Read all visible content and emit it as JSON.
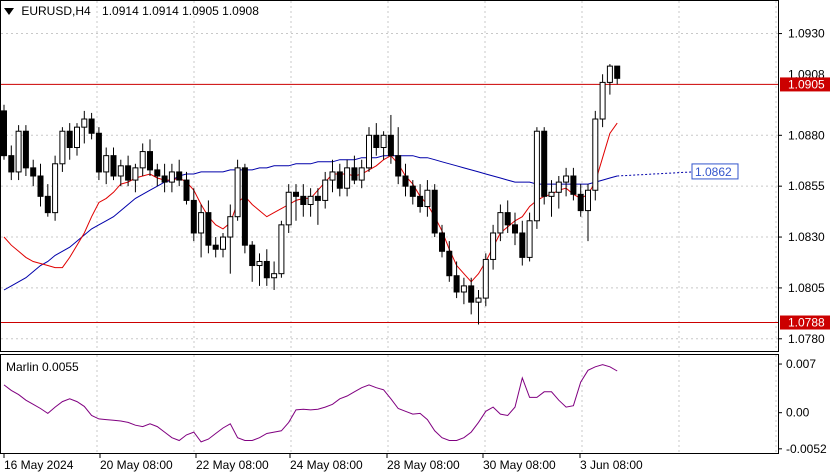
{
  "header": {
    "menu_icon": "triangle-down-icon",
    "symbol": "EURUSD,H4",
    "ohlc": "1.0914 1.0914 1.0905 1.0908"
  },
  "indicator": {
    "label": "Marlin 0.0055"
  },
  "price_axis": {
    "ticks": [
      "1.0930",
      "1.0880",
      "1.0855",
      "1.0830",
      "1.0805",
      "1.0780"
    ],
    "labels": {
      "current": "1.0908",
      "resistance": "1.0905",
      "support": "1.0788",
      "ma_projection": "1.0862"
    }
  },
  "indicator_axis": {
    "ticks": [
      "0.007",
      "0.00",
      "-0.0052"
    ]
  },
  "time_axis": {
    "ticks": [
      "16 May 2024",
      "20 May 08:00",
      "22 May 08:00",
      "24 May 08:00",
      "28 May 08:00",
      "30 May 08:00",
      "3 Jun 08:00"
    ]
  },
  "colors": {
    "background": "#ffffff",
    "grid": "#c8c8c8",
    "bull_body": "#ffffff",
    "bear_body": "#000000",
    "resistance_line": "#cc0000",
    "support_line": "#cc0000",
    "slow_ma": "#0000aa",
    "fast_ma": "#e00000",
    "oscillator": "#800080",
    "projection_label": "#3355cc"
  },
  "chart_data": [
    {
      "type": "candlestick",
      "title": "EURUSD,H4",
      "ylim": [
        1.0774,
        1.0946
      ],
      "x": [
        "16 May 2024",
        "20 May 08:00",
        "22 May 08:00",
        "24 May 08:00",
        "28 May 08:00",
        "30 May 08:00",
        "3 Jun 08:00"
      ],
      "horizontal_levels": [
        {
          "value": 1.0905,
          "label": "1.0905",
          "color": "#cc0000"
        },
        {
          "value": 1.0788,
          "label": "1.0788",
          "color": "#cc0000"
        }
      ],
      "ohlc": [
        [
          1.0892,
          1.0895,
          1.0868,
          1.087
        ],
        [
          1.087,
          1.0875,
          1.0858,
          1.0862
        ],
        [
          1.0862,
          1.0885,
          1.0858,
          1.0882
        ],
        [
          1.0882,
          1.0885,
          1.086,
          1.0864
        ],
        [
          1.0864,
          1.0868,
          1.0855,
          1.086
        ],
        [
          1.086,
          1.0866,
          1.0845,
          1.085
        ],
        [
          1.085,
          1.0856,
          1.084,
          1.0842
        ],
        [
          1.0842,
          1.087,
          1.0838,
          1.0866
        ],
        [
          1.0866,
          1.0884,
          1.0862,
          1.0882
        ],
        [
          1.0882,
          1.0886,
          1.0868,
          1.0874
        ],
        [
          1.0874,
          1.0886,
          1.087,
          1.0884
        ],
        [
          1.0884,
          1.0892,
          1.0876,
          1.0888
        ],
        [
          1.0888,
          1.0891,
          1.0878,
          1.0881
        ],
        [
          1.0881,
          1.0884,
          1.0858,
          1.0862
        ],
        [
          1.0862,
          1.0874,
          1.0856,
          1.087
        ],
        [
          1.087,
          1.0874,
          1.0858,
          1.086
        ],
        [
          1.086,
          1.0868,
          1.0855,
          1.0865
        ],
        [
          1.0865,
          1.087,
          1.0855,
          1.0858
        ],
        [
          1.0858,
          1.0866,
          1.0852,
          1.0864
        ],
        [
          1.0864,
          1.0876,
          1.086,
          1.0872
        ],
        [
          1.0872,
          1.0878,
          1.086,
          1.0863
        ],
        [
          1.0863,
          1.0866,
          1.0855,
          1.086
        ],
        [
          1.086,
          1.0866,
          1.0852,
          1.0857
        ],
        [
          1.0857,
          1.0866,
          1.0852,
          1.0862
        ],
        [
          1.0862,
          1.0868,
          1.0855,
          1.0858
        ],
        [
          1.0858,
          1.0862,
          1.0846,
          1.0848
        ],
        [
          1.0848,
          1.0854,
          1.0828,
          1.0832
        ],
        [
          1.0832,
          1.0846,
          1.082,
          1.0842
        ],
        [
          1.0842,
          1.0848,
          1.0822,
          1.0826
        ],
        [
          1.0826,
          1.083,
          1.082,
          1.0824
        ],
        [
          1.0824,
          1.0832,
          1.082,
          1.083
        ],
        [
          1.083,
          1.0846,
          1.0812,
          1.084
        ],
        [
          1.084,
          1.0868,
          1.0838,
          1.0864
        ],
        [
          1.0864,
          1.0866,
          1.0822,
          1.0826
        ],
        [
          1.0826,
          1.0828,
          1.0808,
          1.0816
        ],
        [
          1.0816,
          1.0822,
          1.0806,
          1.0818
        ],
        [
          1.0818,
          1.0824,
          1.0806,
          1.081
        ],
        [
          1.081,
          1.0818,
          1.0804,
          1.0812
        ],
        [
          1.0812,
          1.0838,
          1.081,
          1.0836
        ],
        [
          1.0836,
          1.0856,
          1.0832,
          1.0852
        ],
        [
          1.0852,
          1.0856,
          1.0838,
          1.085
        ],
        [
          1.085,
          1.0856,
          1.084,
          1.0846
        ],
        [
          1.0846,
          1.0854,
          1.084,
          1.085
        ],
        [
          1.085,
          1.0854,
          1.0836,
          1.0848
        ],
        [
          1.0848,
          1.0862,
          1.0844,
          1.0858
        ],
        [
          1.0858,
          1.0868,
          1.0852,
          1.0862
        ],
        [
          1.0862,
          1.0866,
          1.085,
          1.0854
        ],
        [
          1.0854,
          1.0868,
          1.085,
          1.0864
        ],
        [
          1.0864,
          1.087,
          1.0856,
          1.0858
        ],
        [
          1.0858,
          1.0868,
          1.0854,
          1.0864
        ],
        [
          1.0864,
          1.0884,
          1.0862,
          1.088
        ],
        [
          1.088,
          1.0886,
          1.087,
          1.0874
        ],
        [
          1.0874,
          1.0882,
          1.0868,
          1.088
        ],
        [
          1.088,
          1.089,
          1.0866,
          1.087
        ],
        [
          1.087,
          1.0884,
          1.0856,
          1.086
        ],
        [
          1.086,
          1.0866,
          1.085,
          1.0855
        ],
        [
          1.0855,
          1.0858,
          1.0846,
          1.085
        ],
        [
          1.085,
          1.0856,
          1.0842,
          1.0845
        ],
        [
          1.0845,
          1.0858,
          1.084,
          1.0853
        ],
        [
          1.0853,
          1.0856,
          1.083,
          1.0832
        ],
        [
          1.0832,
          1.0836,
          1.082,
          1.0823
        ],
        [
          1.0823,
          1.0828,
          1.0808,
          1.0811
        ],
        [
          1.0811,
          1.0818,
          1.08,
          1.0803
        ],
        [
          1.0803,
          1.081,
          1.0797,
          1.0806
        ],
        [
          1.0806,
          1.081,
          1.0792,
          1.0798
        ],
        [
          1.0798,
          1.0804,
          1.0787,
          1.08
        ],
        [
          1.08,
          1.0822,
          1.0796,
          1.0819
        ],
        [
          1.0819,
          1.0836,
          1.0814,
          1.0832
        ],
        [
          1.0832,
          1.0846,
          1.0828,
          1.0842
        ],
        [
          1.0842,
          1.0848,
          1.0832,
          1.0836
        ],
        [
          1.0836,
          1.0842,
          1.0826,
          1.0832
        ],
        [
          1.0832,
          1.0838,
          1.0816,
          1.082
        ],
        [
          1.082,
          1.0842,
          1.0818,
          1.0838
        ],
        [
          1.0838,
          1.0884,
          1.0834,
          1.0882
        ],
        [
          1.0882,
          1.0884,
          1.0846,
          1.085
        ],
        [
          1.085,
          1.0858,
          1.084,
          1.0852
        ],
        [
          1.0852,
          1.086,
          1.0844,
          1.0857
        ],
        [
          1.0857,
          1.0864,
          1.085,
          1.086
        ],
        [
          1.086,
          1.0864,
          1.0848,
          1.0851
        ],
        [
          1.0851,
          1.0856,
          1.084,
          1.0843
        ],
        [
          1.0843,
          1.0856,
          1.0828,
          1.0853
        ],
        [
          1.0853,
          1.0892,
          1.0848,
          1.0888
        ],
        [
          1.0888,
          1.091,
          1.0884,
          1.0906
        ],
        [
          1.0906,
          1.0915,
          1.09,
          1.0914
        ],
        [
          1.0914,
          1.0914,
          1.0905,
          1.0908
        ]
      ]
    },
    {
      "type": "line",
      "series": [
        {
          "values": [
            1.083,
            1.0826,
            1.0823,
            1.082,
            1.0818,
            1.0817,
            1.0816,
            1.0815,
            1.0815,
            1.082,
            1.0826,
            1.0832,
            1.084,
            1.0847,
            1.0849,
            1.0852,
            1.0856,
            1.0857,
            1.0859,
            1.086,
            1.0861,
            1.0859,
            1.0858,
            1.0858,
            1.0859,
            1.0857,
            1.0853,
            1.0846,
            1.084,
            1.0836,
            1.0834,
            1.0837,
            1.0847,
            1.085,
            1.0846,
            1.0843,
            1.084,
            1.0842,
            1.0844,
            1.0846,
            1.0848,
            1.0849,
            1.0849,
            1.0853,
            1.0857,
            1.0861,
            1.0861,
            1.0861,
            1.086,
            1.0861,
            1.0863,
            1.0865,
            1.0868,
            1.087,
            1.0866,
            1.086,
            1.0856,
            1.085,
            1.0846,
            1.084,
            1.0833,
            1.0824,
            1.0816,
            1.0812,
            1.0808,
            1.0812,
            1.0818,
            1.0825,
            1.0832,
            1.0835,
            1.0838,
            1.084,
            1.0845,
            1.0848,
            1.085,
            1.0851,
            1.0853,
            1.0854,
            1.0851,
            1.0849,
            1.0851,
            1.0857,
            1.0869,
            1.0881,
            1.0886
          ]
        },
        {
          "values": [
            1.0804,
            1.0806,
            1.0808,
            1.081,
            1.0813,
            1.0816,
            1.0818,
            1.0821,
            1.0823,
            1.0825,
            1.0828,
            1.0831,
            1.0834,
            1.0836,
            1.0838,
            1.084,
            1.0843,
            1.0846,
            1.0849,
            1.0851,
            1.0853,
            1.0855,
            1.0857,
            1.0858,
            1.086,
            1.0861,
            1.0861,
            1.0862,
            1.0862,
            1.0862,
            1.0862,
            1.0863,
            1.0863,
            1.0863,
            1.0863,
            1.0864,
            1.0864,
            1.0865,
            1.0865,
            1.0865,
            1.0866,
            1.0866,
            1.0866,
            1.0867,
            1.0867,
            1.0867,
            1.0868,
            1.0868,
            1.0868,
            1.0869,
            1.0869,
            1.0869,
            1.087,
            1.087,
            1.087,
            1.087,
            1.087,
            1.0869,
            1.0869,
            1.0868,
            1.0867,
            1.0866,
            1.0865,
            1.0864,
            1.0863,
            1.0862,
            1.0861,
            1.086,
            1.0859,
            1.0858,
            1.0857,
            1.0857,
            1.0857,
            1.0856,
            1.0856,
            1.0856,
            1.0856,
            1.0856,
            1.0856,
            1.0856,
            1.0856,
            1.0857,
            1.0858,
            1.0859,
            1.086
          ]
        }
      ],
      "projection": {
        "value": 1.0862,
        "label": "1.0862"
      }
    },
    {
      "type": "line",
      "title": "Marlin 0.0055",
      "ylim": [
        -0.0058,
        0.0083
      ],
      "series": [
        {
          "values": [
            0.004,
            0.0032,
            0.0026,
            0.0018,
            0.0012,
            0.0006,
            -0.0001,
            0.0008,
            0.0016,
            0.002,
            0.0016,
            0.0009,
            -0.0004,
            -0.0009,
            -0.001,
            -0.0011,
            -0.0012,
            -0.0014,
            -0.0018,
            -0.002,
            -0.0016,
            -0.002,
            -0.0028,
            -0.0036,
            -0.004,
            -0.0032,
            -0.0028,
            -0.0042,
            -0.0038,
            -0.003,
            -0.0022,
            -0.0016,
            -0.0036,
            -0.004,
            -0.004,
            -0.0036,
            -0.003,
            -0.0028,
            -0.0026,
            -0.0014,
            0.0004,
            0.0005,
            0.0004,
            0.0005,
            0.0008,
            0.0012,
            0.002,
            0.0024,
            0.003,
            0.0036,
            0.004,
            0.0036,
            0.0033,
            0.002,
            0.0006,
            0.0002,
            -0.0002,
            -0.0001,
            -0.001,
            -0.0026,
            -0.0036,
            -0.004,
            -0.004,
            -0.0036,
            -0.0028,
            -0.0014,
            0.0002,
            0.0008,
            -0.0002,
            -0.0004,
            0.0008,
            0.005,
            0.0022,
            0.0022,
            0.003,
            0.003,
            0.0018,
            0.0008,
            0.001,
            0.0044,
            0.0061,
            0.0066,
            0.0069,
            0.0066,
            0.006
          ]
        }
      ]
    }
  ]
}
